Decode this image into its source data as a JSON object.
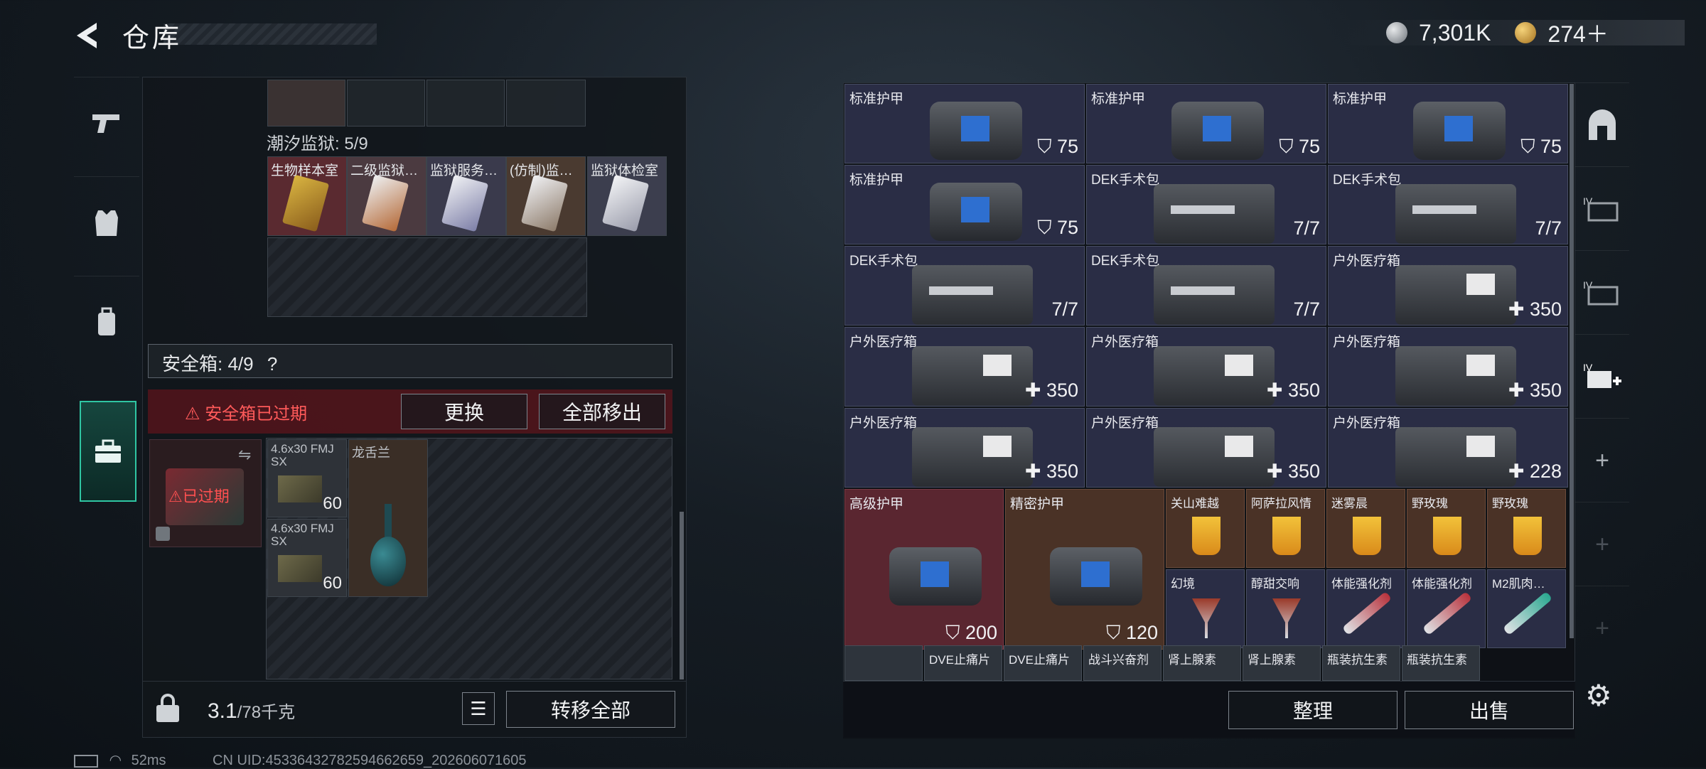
{
  "header": {
    "title": "仓库",
    "currency1": "7,301K",
    "currency2": "274＋"
  },
  "left": {
    "top_items_labels": [
      "",
      "",
      "",
      ""
    ],
    "region_label": "潮汐监狱: 5/9",
    "keycards": [
      "生物样本室",
      "二级监狱…",
      "监狱服务…",
      "(仿制)监…",
      "监狱体检室"
    ],
    "safebox_label": "安全箱: 4/9",
    "safebox_help": "?",
    "expired_notice": "安全箱已过期",
    "replace_btn": "更换",
    "move_all_out_btn": "全部移出",
    "safebox_item_expired": "已过期",
    "safe_items": [
      {
        "name": "4.6x30 FMJ SX",
        "count": "60"
      },
      {
        "name": "龙舌兰",
        "count": ""
      },
      {
        "name": "4.6x30 FMJ SX",
        "count": "60"
      }
    ],
    "weight": "3.1",
    "weight_max": "/78千克",
    "transfer_all_btn": "转移全部"
  },
  "right": {
    "items": [
      {
        "name": "标准护甲",
        "value": "75"
      },
      {
        "name": "标准护甲",
        "value": "75"
      },
      {
        "name": "标准护甲",
        "value": "75"
      },
      {
        "name": "标准护甲",
        "value": "75"
      },
      {
        "name": "DEK手术包",
        "value": "7/7"
      },
      {
        "name": "DEK手术包",
        "value": "7/7"
      },
      {
        "name": "DEK手术包",
        "value": "7/7"
      },
      {
        "name": "DEK手术包",
        "value": "7/7"
      },
      {
        "name": "户外医疗箱",
        "value": "350"
      },
      {
        "name": "户外医疗箱",
        "value": "350"
      },
      {
        "name": "户外医疗箱",
        "value": "350"
      },
      {
        "name": "户外医疗箱",
        "value": "350"
      },
      {
        "name": "户外医疗箱",
        "value": "350"
      },
      {
        "name": "户外医疗箱",
        "value": "350"
      },
      {
        "name": "户外医疗箱",
        "value": "228"
      },
      {
        "name": "高级护甲",
        "value": "200"
      },
      {
        "name": "精密护甲",
        "value": "120"
      }
    ],
    "drinks_row1": [
      "关山难越",
      "阿萨拉风情",
      "迷雾晨",
      "野玫瑰",
      "野玫瑰"
    ],
    "drinks_row2": [
      "幻境",
      "醇甜交响",
      "体能强化剂",
      "体能强化剂",
      "M2肌肉…"
    ],
    "bottom_row": [
      "DVE止痛片",
      "DVE止痛片",
      "战斗兴奋剂",
      "肾上腺素",
      "肾上腺素",
      "瓶装抗生素",
      "瓶装抗生素"
    ],
    "sort_btn": "整理",
    "sell_btn": "出售"
  },
  "status": {
    "ping": "52ms",
    "uid": "CN UID:45336432782594662659_202606071605"
  },
  "colors": {
    "accent": "#2fc6a3",
    "warning": "#ff5a5a"
  }
}
